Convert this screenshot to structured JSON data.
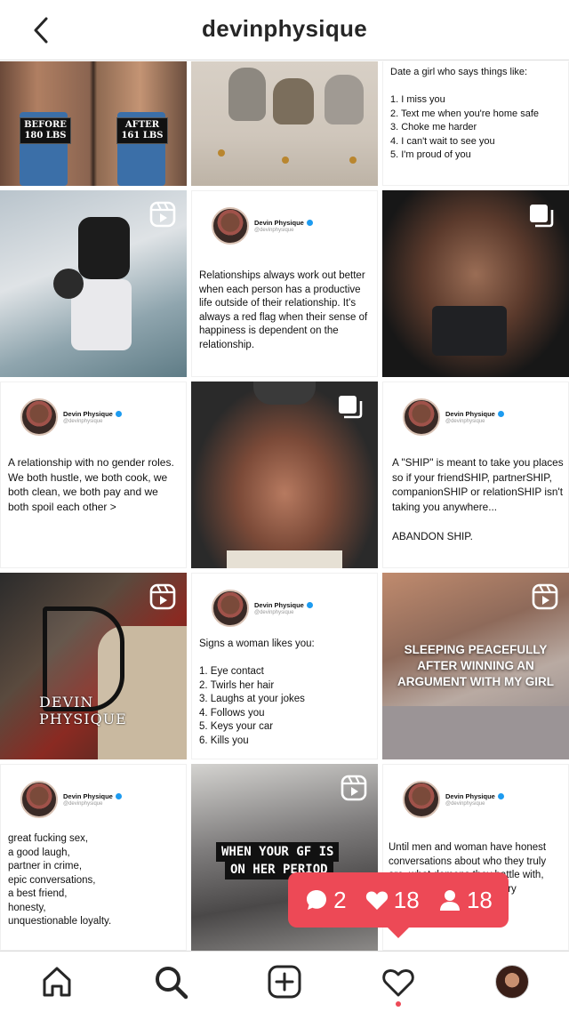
{
  "header": {
    "title": "devinphysique",
    "back_icon": "chevron-left-icon"
  },
  "posts": {
    "p1": {
      "before_label": "BEFORE",
      "before_weight": "180 LBS",
      "after_label": "AFTER",
      "after_weight": "161 LBS"
    },
    "p3": {
      "text": "Date a girl who says things like:\n\n1. I miss you\n2. Text me when you're home safe\n3. Choke me harder\n4. I can't wait to see you\n5.  I'm proud of you"
    },
    "p5": {
      "name": "Devin Physique",
      "handle": "@devinphysique",
      "text": "Relationships always work out better when each person has a productive life outside of their relationship. It's always a red flag when their sense of happiness is dependent on the relationship."
    },
    "p7": {
      "name": "Devin Physique",
      "handle": "@devinphysique",
      "text": "A relationship with no gender roles. We both hustle, we both cook, we both clean, we both pay and we both spoil each other >"
    },
    "p9": {
      "name": "Devin Physique",
      "handle": "@devinphysique",
      "text": "A \"SHIP\" is meant to take you places so if your friendSHIP, partnerSHIP, companionSHIP or relationSHIP isn't taking you anywhere...\n\nABANDON SHIP."
    },
    "p10": {
      "logo_text": "DEVIN PHYSIQUE"
    },
    "p11": {
      "name": "Devin Physique",
      "handle": "@devinphysique",
      "text": "Signs a woman likes you:\n\n1. Eye contact\n2. Twirls her hair\n3. Laughs at your jokes\n4. Follows you\n5. Keys your car\n6. Kills you"
    },
    "p12": {
      "caption": "SLEEPING PEACEFULLY\nAFTER WINNING AN\nARGUMENT WITH MY GIRL"
    },
    "p13": {
      "name": "Devin Physique",
      "handle": "@devinphysique",
      "text": "great fucking sex,\na good laugh,\npartner in crime,\nepic conversations,\na best friend,\nhonesty,\nunquestionable loyalty."
    },
    "p14": {
      "caption_line1": "WHEN YOUR GF IS",
      "caption_line2": "ON HER PERIOD"
    },
    "p15": {
      "name": "Devin Physique",
      "handle": "@devinphysique",
      "text": "Until men and woman have honest conversations about who they truly are, what demons they battle with, where … y want, love … ary"
    }
  },
  "notification": {
    "comments": "2",
    "likes": "18",
    "follows": "18",
    "color": "#ed4956"
  },
  "tabs": {
    "home": "home-icon",
    "search": "search-icon",
    "new_post": "plus-square-icon",
    "activity": "heart-icon",
    "profile": "profile-avatar"
  }
}
